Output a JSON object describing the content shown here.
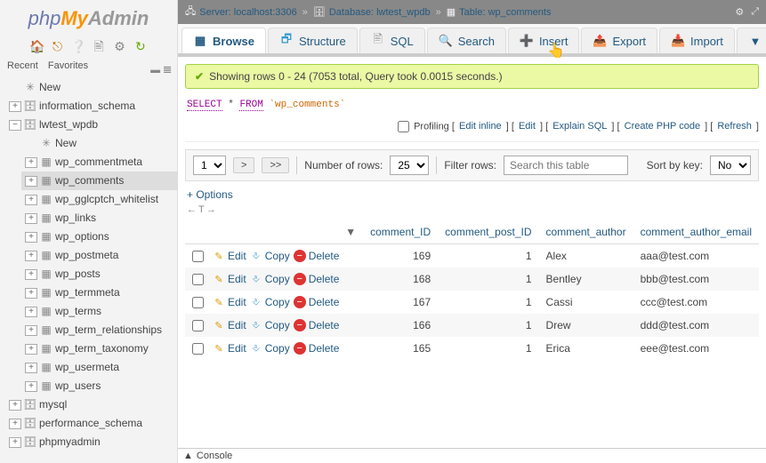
{
  "logo": {
    "php": "php",
    "my": "My",
    "admin": "Admin"
  },
  "sidebar_tabs": {
    "recent": "Recent",
    "favorites": "Favorites"
  },
  "tree": {
    "new": "New",
    "dbs": [
      {
        "name": "information_schema"
      },
      {
        "name": "lwtest_wpdb",
        "expanded": true,
        "children": [
          "New",
          "wp_commentmeta",
          "wp_comments",
          "wp_gglcptch_whitelist",
          "wp_links",
          "wp_options",
          "wp_postmeta",
          "wp_posts",
          "wp_termmeta",
          "wp_terms",
          "wp_term_relationships",
          "wp_term_taxonomy",
          "wp_usermeta",
          "wp_users"
        ],
        "selected": "wp_comments"
      },
      {
        "name": "mysql"
      },
      {
        "name": "performance_schema"
      },
      {
        "name": "phpmyadmin"
      }
    ]
  },
  "breadcrumb": {
    "server_label": "Server:",
    "server": "localhost:3306",
    "db_label": "Database:",
    "db": "lwtest_wpdb",
    "table_label": "Table:",
    "table": "wp_comments"
  },
  "tabs": {
    "browse": "Browse",
    "structure": "Structure",
    "sql": "SQL",
    "search": "Search",
    "insert": "Insert",
    "export": "Export",
    "import": "Import",
    "more": "More"
  },
  "success": "Showing rows 0 - 24 (7053 total, Query took 0.0015 seconds.)",
  "query": {
    "select": "SELECT",
    "star": "*",
    "from": "FROM",
    "table": "`wp_comments`"
  },
  "query_links": {
    "profiling": "Profiling",
    "edit_inline": "Edit inline",
    "edit": "Edit",
    "explain": "Explain SQL",
    "create_php": "Create PHP code",
    "refresh": "Refresh"
  },
  "controls": {
    "page": "1",
    "next": ">",
    "last": ">>",
    "num_rows_label": "Number of rows:",
    "num_rows": "25",
    "filter_label": "Filter rows:",
    "filter_placeholder": "Search this table",
    "sort_label": "Sort by key:",
    "sort_value": "No"
  },
  "options": "+ Options",
  "sort_hint": "←T→",
  "columns": [
    "comment_ID",
    "comment_post_ID",
    "comment_author",
    "comment_author_email"
  ],
  "row_actions": {
    "edit": "Edit",
    "copy": "Copy",
    "delete": "Delete"
  },
  "rows": [
    {
      "comment_ID": 169,
      "comment_post_ID": 1,
      "comment_author": "Alex",
      "comment_author_email": "aaa@test.com"
    },
    {
      "comment_ID": 168,
      "comment_post_ID": 1,
      "comment_author": "Bentley",
      "comment_author_email": "bbb@test.com"
    },
    {
      "comment_ID": 167,
      "comment_post_ID": 1,
      "comment_author": "Cassi",
      "comment_author_email": "ccc@test.com"
    },
    {
      "comment_ID": 166,
      "comment_post_ID": 1,
      "comment_author": "Drew",
      "comment_author_email": "ddd@test.com"
    },
    {
      "comment_ID": 165,
      "comment_post_ID": 1,
      "comment_author": "Erica",
      "comment_author_email": "eee@test.com"
    }
  ],
  "console": "Console"
}
